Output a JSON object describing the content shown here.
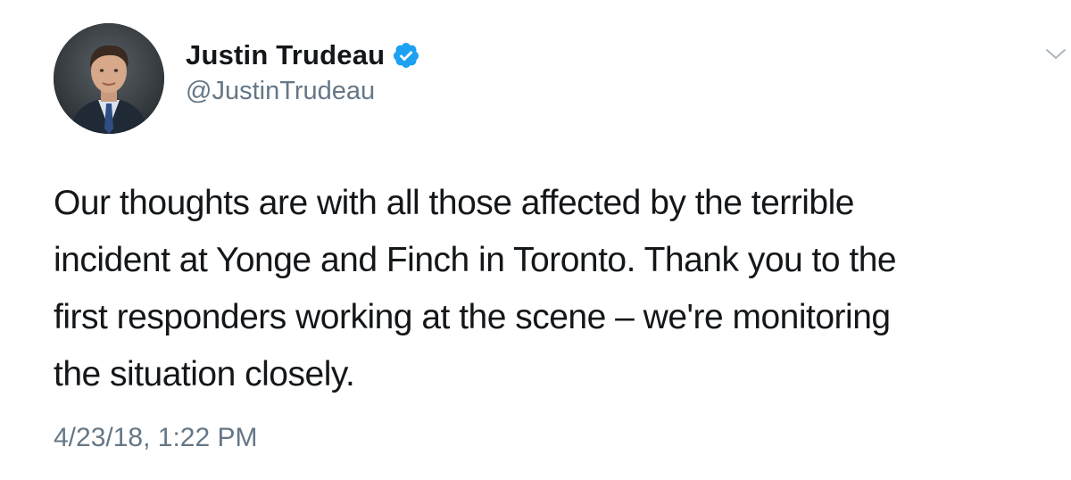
{
  "author": {
    "display_name": "Justin Trudeau",
    "handle": "@JustinTrudeau",
    "verified": true
  },
  "tweet": {
    "text": "Our thoughts are with all those affected by the terrible\nincident at Yonge and Finch in Toronto. Thank you to the\nfirst responders working at the scene – we're monitoring\nthe situation closely.",
    "timestamp": "4/23/18, 1:22 PM"
  },
  "icons": {
    "verified": "verified-badge-icon",
    "menu": "chevron-down-icon"
  },
  "colors": {
    "verified_blue": "#1da1f2",
    "secondary_text": "#657786",
    "primary_text": "#14171a"
  }
}
